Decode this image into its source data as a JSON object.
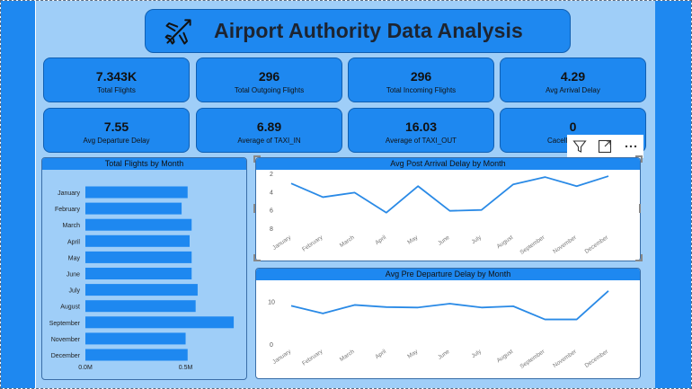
{
  "header": {
    "title": "Airport Authority Data Analysis",
    "icon": "airplane-icon"
  },
  "kpis": [
    {
      "value": "7.343K",
      "label": "Total Flights"
    },
    {
      "value": "296",
      "label": "Total Outgoing Flights"
    },
    {
      "value": "296",
      "label": "Total Incoming Flights"
    },
    {
      "value": "4.29",
      "label": "Avg Arrival Delay"
    },
    {
      "value": "7.55",
      "label": "Avg Departure Delay"
    },
    {
      "value": "6.89",
      "label": "Average of TAXI_IN"
    },
    {
      "value": "16.03",
      "label": "Average of TAXI_OUT"
    },
    {
      "value": "0",
      "label": "Cacelled Flights"
    }
  ],
  "visual_toolbar": {
    "icons": [
      "filter-icon",
      "focus-mode-icon",
      "more-options-icon"
    ]
  },
  "colors": {
    "canvas": "#9fcef8",
    "accent": "#1e88f0",
    "line": "#2a8ae6"
  },
  "chart_data": [
    {
      "type": "bar",
      "orientation": "horizontal",
      "title": "Total Flights by Month",
      "categories": [
        "January",
        "February",
        "March",
        "April",
        "May",
        "June",
        "July",
        "August",
        "September",
        "November",
        "December"
      ],
      "values": [
        0.51,
        0.48,
        0.53,
        0.52,
        0.53,
        0.53,
        0.56,
        0.55,
        0.74,
        0.5,
        0.51
      ],
      "xlim": [
        0,
        0.78
      ],
      "xticks": [
        "0.0M",
        "0.5M"
      ],
      "grid": false
    },
    {
      "type": "line",
      "title": "Avg Post Arrival Delay by Month",
      "x": [
        "January",
        "February",
        "March",
        "April",
        "May",
        "June",
        "July",
        "August",
        "September",
        "November",
        "December"
      ],
      "values": [
        3.1,
        4.6,
        4.1,
        6.3,
        3.4,
        6.1,
        6.0,
        3.2,
        2.4,
        3.4,
        2.3
      ],
      "ylim": [
        2,
        8
      ],
      "yticks": [
        "2",
        "4",
        "6",
        "8"
      ],
      "y_reversed": true,
      "grid": false
    },
    {
      "type": "line",
      "title": "Avg Pre Departure Delay by Month",
      "x": [
        "January",
        "February",
        "March",
        "April",
        "May",
        "June",
        "July",
        "August",
        "September",
        "November",
        "December"
      ],
      "values": [
        9.0,
        7.2,
        9.2,
        8.7,
        8.6,
        9.5,
        8.6,
        8.9,
        5.8,
        5.8,
        12.5
      ],
      "ylim": [
        0,
        15
      ],
      "yticks": [
        "10",
        "0"
      ],
      "grid": false
    }
  ]
}
